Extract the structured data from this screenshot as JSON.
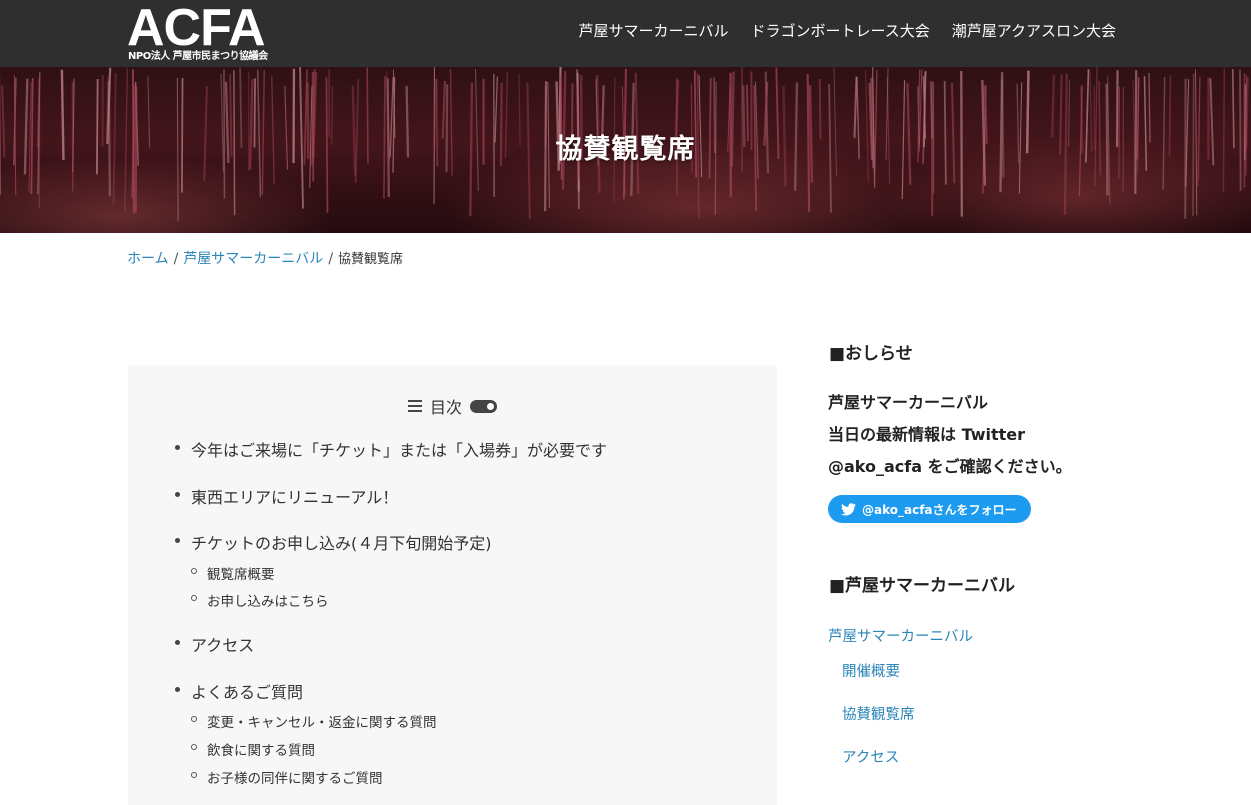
{
  "header": {
    "logo_main": "ACFA",
    "logo_sub": "NPO法人 芦屋市民まつり協議会",
    "nav": [
      "芦屋サマーカーニバル",
      "ドラゴンボートレース大会",
      "潮芦屋アクアスロン大会"
    ]
  },
  "hero": {
    "title": "協賛観覧席"
  },
  "breadcrumb": {
    "home": "ホーム",
    "parent": "芦屋サマーカーニバル",
    "current": "協賛観覧席",
    "separator": "/"
  },
  "toc": {
    "heading": "目次",
    "items": [
      "今年はご来場に「チケット」または「入場券」が必要です",
      "東西エリアにリニューアル！",
      "チケットのお申し込み(４月下旬開始予定)",
      "アクセス",
      "よくあるご質問"
    ],
    "sub_tickets": [
      "観覧席概要",
      "お申し込みはこちら"
    ],
    "sub_faq": [
      "変更・キャンセル・返金に関する質問",
      "飲食に関する質問",
      "お子様の同伴に関するご質問"
    ]
  },
  "sidebar": {
    "notice_heading": "■おしらせ",
    "notice_lines": [
      "芦屋サマーカーニバル",
      "当日の最新情報は Twitter",
      "@ako_acfa をご確認ください。"
    ],
    "twitter_button": "@ako_acfaさんをフォロー",
    "carnival_heading": "■芦屋サマーカーニバル",
    "carnival_link": "芦屋サマーカーニバル",
    "carnival_sublinks": [
      "開催概要",
      "協賛観覧席",
      "アクセス"
    ]
  },
  "colors": {
    "header_bg": "#2f2f2f",
    "link": "#2a85b8",
    "twitter": "#1d9bf0",
    "toc_bg": "#f7f7f7"
  }
}
